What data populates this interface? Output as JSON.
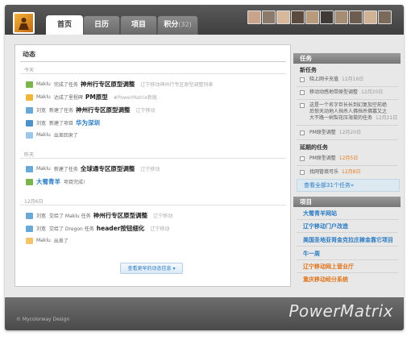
{
  "nav": {
    "tabs": [
      {
        "label": "首页"
      },
      {
        "label": "日历"
      },
      {
        "label": "项目"
      },
      {
        "label": "积分",
        "count": "(32)"
      }
    ]
  },
  "colors": {
    "accent": "#2b7bc4",
    "warning": "#e07319"
  },
  "feed": {
    "title": "动态",
    "sections": [
      {
        "label": "今天"
      },
      {
        "label": "昨天"
      },
      {
        "label": "12月6日"
      }
    ],
    "items": [
      {
        "user": "Maklu",
        "action": "完成了任务",
        "target": "神州行专区原型调整",
        "note": "辽宁移动神州行专区原型调整列表"
      },
      {
        "user": "Maklu",
        "action": "达成了里程碑",
        "target": "PM原型",
        "note": "#PowerMatrix新版"
      },
      {
        "user": "刘宽",
        "action": "新建了任务",
        "target": "神州行专区原型调整",
        "note": "辽宁移动"
      },
      {
        "user": "刘宽",
        "action": "新建了项目",
        "target": "华为深圳"
      },
      {
        "user": "Maklu",
        "action": "出差回来了"
      },
      {
        "user": "Maklu",
        "action": "新建了任务",
        "target": "全球通专区原型调整",
        "note": "辽宁移动"
      },
      {
        "target": "大蜀青羊",
        "note": "项目完成!"
      },
      {
        "user": "刘宽",
        "action": "交给了 Maklu 任务",
        "target": "神州行专区原型调整",
        "note": "辽宁移动"
      },
      {
        "user": "刘宽",
        "action": "交给了 Dregon 任务",
        "target": "header按钮细化",
        "note": "辽宁移动"
      },
      {
        "user": "Maklu",
        "action": "出差了"
      }
    ],
    "more_label": "查看更早的动态信息 ▾"
  },
  "tasks": {
    "heading": "任务",
    "new_heading": "新任务",
    "new": [
      {
        "text": "晓上网卡充值",
        "date": "12月16日"
      },
      {
        "text": "移动动感地带原型调整",
        "date": "12月20日"
      },
      {
        "lines": [
          "这是一个名字巨长长到幻复加空前绝",
          "后惊天动地人挡杀人佛挡杀佛寡又之",
          "大不路一树梨花压海棠的任务"
        ],
        "date": "12月21日"
      },
      {
        "text": "PM原型调整",
        "date": "12月20日"
      }
    ],
    "overdue_heading": "延期的任务",
    "overdue": [
      {
        "text": "PM原型调整",
        "date": "12月5日"
      },
      {
        "text": "找网管填可乐",
        "date": "12月8日"
      }
    ],
    "all_label": "查看全部31个任务»"
  },
  "projects": {
    "heading": "项目",
    "items": [
      {
        "label": "大蜀青羊网站"
      },
      {
        "label": "辽宁移动门户改造"
      },
      {
        "label": "美国圣地亚哥金克拉庄稼金靠它项目"
      },
      {
        "label": "牛一周"
      },
      {
        "label": "辽宁移动网上营业厅"
      },
      {
        "label": "重庆移动经分系统"
      }
    ]
  },
  "footer": {
    "copyright": "© Mycolorway Design",
    "brand": "PowerMatrix"
  }
}
